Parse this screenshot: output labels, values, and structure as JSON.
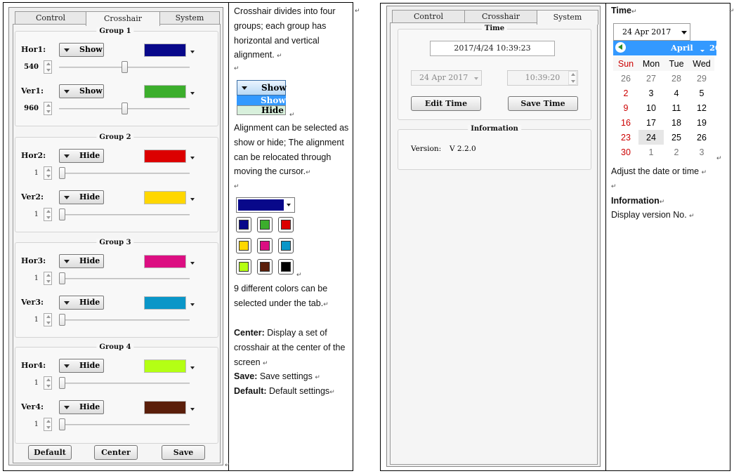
{
  "colors": {
    "navy": "#08088a",
    "green": "#3cae2c",
    "red": "#dc0000",
    "yellow": "#ffd700",
    "magenta": "#dc0f82",
    "cyan": "#0a96c8",
    "lime": "#b4ff14",
    "brown": "#5a1e0a",
    "black": "#000000"
  },
  "crosshair_panel": {
    "tabs": [
      "Control",
      "Crosshair",
      "System"
    ],
    "groups": [
      {
        "title": "Group 1",
        "rows": [
          {
            "label": "Hor1:",
            "mode": "Show",
            "value": "540"
          },
          {
            "label": "Ver1:",
            "mode": "Show",
            "value": "960"
          }
        ]
      },
      {
        "title": "Group 2",
        "rows": [
          {
            "label": "Hor2:",
            "mode": "Hide",
            "value": "1"
          },
          {
            "label": "Ver2:",
            "mode": "Hide",
            "value": "1"
          }
        ]
      },
      {
        "title": "Group 3",
        "rows": [
          {
            "label": "Hor3:",
            "mode": "Hide",
            "value": "1"
          },
          {
            "label": "Ver3:",
            "mode": "Hide",
            "value": "1"
          }
        ]
      },
      {
        "title": "Group 4",
        "rows": [
          {
            "label": "Hor4:",
            "mode": "Hide",
            "value": "1"
          },
          {
            "label": "Ver4:",
            "mode": "Hide",
            "value": "1"
          }
        ]
      }
    ],
    "buttons": {
      "default": "Default",
      "center": "Center",
      "save": "Save"
    }
  },
  "crosshair_desc": {
    "intro": "Crosshair divides into four groups; each group has horizontal and vertical alignment.",
    "dd_show": "Show",
    "dd_hide": "Hide",
    "align": "Alignment can be selected as show or hide; The alignment can be relocated through moving the cursor.",
    "colors_text": "9 different colors can be selected under the tab.",
    "center_label": "Center:",
    "center_text": "Display a set of crosshair at the center of the screen",
    "save_label": "Save:",
    "save_text": "Save settings",
    "default_label": "Default:",
    "default_text": "Default settings"
  },
  "system_panel": {
    "tabs": [
      "Control",
      "Crosshair",
      "System"
    ],
    "time_title": "Time",
    "datetime": "2017/4/24    10:39:23",
    "date_field": "24 Apr 2017",
    "time_field": "10:39:20",
    "edit_time": "Edit Time",
    "save_time": "Save Time",
    "info_title": "Information",
    "version_label": "Version:",
    "version_value": "V 2.2.0"
  },
  "system_desc": {
    "time_heading": "Time",
    "date_select": "24 Apr 2017",
    "month": "April",
    "year_partial": "20",
    "weekdays": [
      "Sun",
      "Mon",
      "Tue",
      "Wed"
    ],
    "weeks": [
      [
        "26",
        "27",
        "28",
        "29"
      ],
      [
        "2",
        "3",
        "4",
        "5"
      ],
      [
        "9",
        "10",
        "11",
        "12"
      ],
      [
        "16",
        "17",
        "18",
        "19"
      ],
      [
        "23",
        "24",
        "25",
        "26"
      ],
      [
        "30",
        "1",
        "2",
        "3"
      ]
    ],
    "adjust": "Adjust the date or time",
    "info_heading": "Information",
    "info_text": "Display version No."
  }
}
